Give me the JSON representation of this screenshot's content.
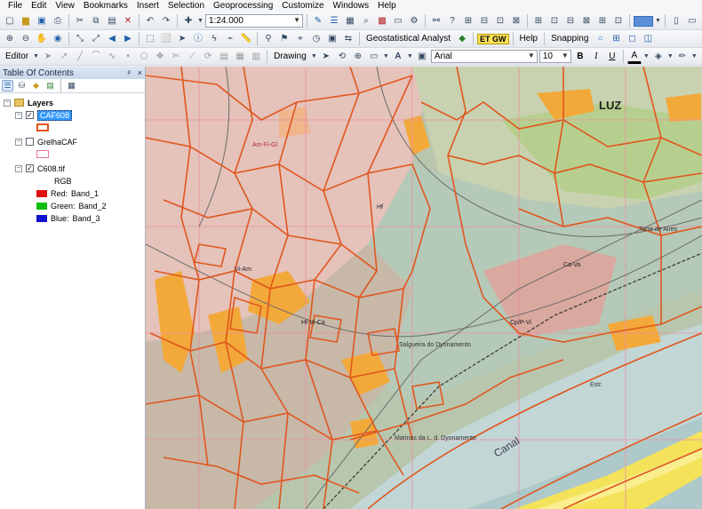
{
  "menubar": {
    "items": [
      "File",
      "Edit",
      "View",
      "Bookmarks",
      "Insert",
      "Selection",
      "Geoprocessing",
      "Customize",
      "Windows",
      "Help"
    ]
  },
  "toolbar_standard": {
    "scale_value": "1:24.000"
  },
  "toolbar_tools": {
    "geostatistical_label": "Geostatistical Analyst",
    "gw_label": "ET GW",
    "help_label": "Help",
    "snapping_label": "Snapping"
  },
  "toolbar_editor": {
    "editor_label": "Editor",
    "drawing_label": "Drawing",
    "font_name": "Arial",
    "font_size": "10",
    "bold_label": "B",
    "italic_label": "I",
    "underline_label": "U",
    "text_tool_label": "A",
    "font_color_label": "A"
  },
  "toc": {
    "title": "Table Of Contents",
    "pin_glyph": "ᵖ",
    "close_glyph": "×",
    "layers_label": "Layers",
    "items": [
      {
        "label": "CAF608",
        "checked": true,
        "selected": true,
        "symbol_color": "#e0561e"
      },
      {
        "label": "GrelhaCAF",
        "checked": false,
        "selected": false,
        "symbol_color": "#e37a8c"
      },
      {
        "label": "C608.tif",
        "checked": true,
        "selected": false,
        "renderer": "RGB",
        "bands": [
          {
            "channel": "Red:",
            "band": "Band_1",
            "color": "#e01010"
          },
          {
            "channel": "Green:",
            "band": "Band_2",
            "color": "#10c010"
          },
          {
            "channel": "Blue:",
            "band": "Band_3",
            "color": "#1010d0"
          }
        ]
      }
    ]
  },
  "map": {
    "labels": [
      {
        "text": "LUZ"
      },
      {
        "text": "Canal"
      },
      {
        "text": "Salgueira do Dyonamento"
      },
      {
        "text": "Marinas da L. d. Dyonamento"
      },
      {
        "text": "Am-Fi-Gl"
      },
      {
        "text": "Hf-Vi-Ca"
      },
      {
        "text": "Ca-Va"
      },
      {
        "text": "Cp/P-Vi"
      },
      {
        "text": "Hf"
      },
      {
        "text": "Vi-Am"
      },
      {
        "text": "Torre de Aires"
      },
      {
        "text": "Estr."
      }
    ],
    "colors": {
      "polygon_outline": "#e0561e",
      "grid_line": "#e890a0",
      "orange_fill": "#f3a93a",
      "pink_fill": "#e9b9b2",
      "green_fill": "#a9c79a",
      "yellow_fill": "#f4e25a",
      "water_fill": "#c2d6d6"
    }
  }
}
